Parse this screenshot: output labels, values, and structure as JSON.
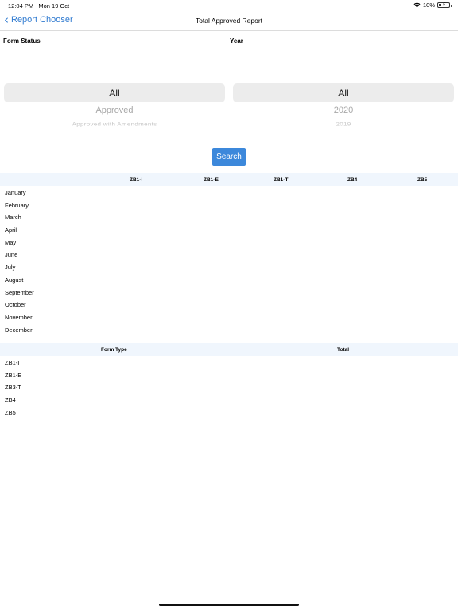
{
  "status_bar": {
    "time": "12:04 PM",
    "date": "Mon 19 Oct",
    "battery": "10%",
    "wifi_icon": "wifi-icon"
  },
  "nav": {
    "back_label": "Report Chooser",
    "title": "Total Approved Report"
  },
  "filters": {
    "form_status_label": "Form Status",
    "year_label": "Year",
    "form_status_options": [
      "All",
      "Approved",
      "Approved with Amendments"
    ],
    "year_options": [
      "All",
      "2020",
      "2019"
    ]
  },
  "search_label": "Search",
  "monthly_table": {
    "columns": [
      "ZB1-I",
      "ZB1-E",
      "ZB1-T",
      "ZB4",
      "ZB5"
    ],
    "rows": [
      "January",
      "February",
      "March",
      "April",
      "May",
      "June",
      "July",
      "August",
      "September",
      "October",
      "November",
      "December"
    ]
  },
  "total_table": {
    "columns": [
      "Form Type",
      "Total"
    ],
    "rows": [
      "ZB1-I",
      "ZB1-E",
      "ZB3-T",
      "ZB4",
      "ZB5"
    ]
  }
}
